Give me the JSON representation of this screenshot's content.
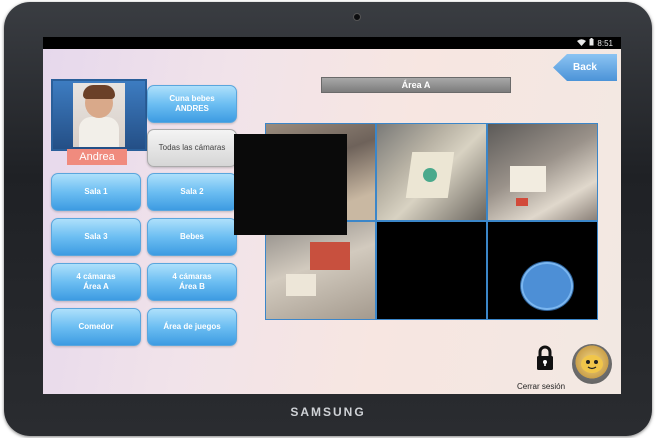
{
  "device": {
    "brand": "SAMSUNG"
  },
  "status_bar": {
    "time": "8:51"
  },
  "header": {
    "back_label": "Back",
    "area_title": "Área A"
  },
  "profile": {
    "name": "Andrea"
  },
  "menu": {
    "cuna_bebes": "Cuna bebes\nANDRES",
    "todas_camaras": "Todas las cámaras",
    "sala1": "Sala 1",
    "sala2": "Sala 2",
    "sala3": "Sala 3",
    "bebes": "Bebes",
    "cam4_a": "4 cámaras\nÁrea A",
    "cam4_b": "4 cámaras\nÁrea B",
    "comedor": "Comedor",
    "area_juegos": "Área de juegos"
  },
  "footer": {
    "logout_label": "Cerrar sesión"
  },
  "colors": {
    "button_blue": "#6cbef2",
    "accent_name": "#f08b7e",
    "border_blue": "#3b86c9"
  },
  "icons": {
    "back": "back-arrow-icon",
    "lock": "lock-icon",
    "wifi": "wifi-icon",
    "battery": "battery-icon"
  }
}
